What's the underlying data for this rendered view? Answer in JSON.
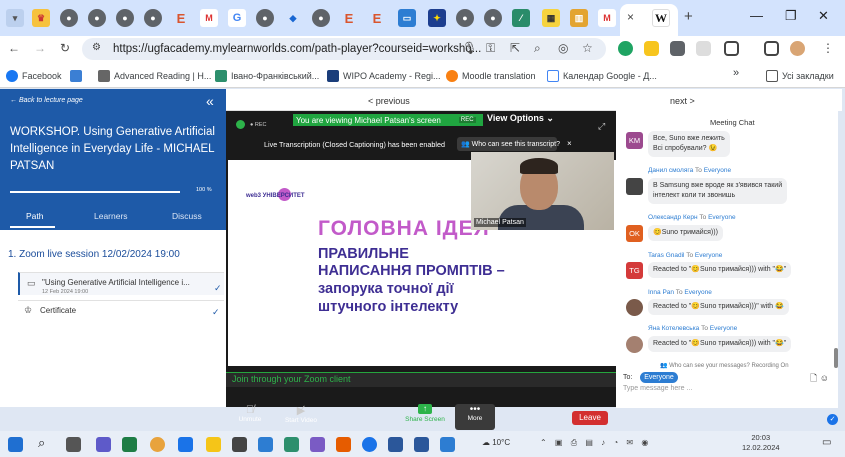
{
  "browser": {
    "url": "https://ugfacademy.mylearnworlds.com/path-player?courseid=worksho...",
    "active_tab_letter": "W",
    "tab_close": "×",
    "new_tab": "+",
    "bookmarks": [
      {
        "label": "Facebook"
      },
      {
        "label": "Advanced Reading | H..."
      },
      {
        "label": "Івано-Франківський..."
      },
      {
        "label": "WIPO Academy - Regi..."
      },
      {
        "label": "Moodle translation"
      },
      {
        "label": "Календар Google - Д..."
      }
    ],
    "bookmarks_more": "»",
    "all_bookmarks": "Усі закладки"
  },
  "course": {
    "back_label": "Back to lecture page",
    "title": "WORKSHOP. Using Generative Artificial Intelligence in Everyday Life - MICHAEL PATSAN",
    "progress_label": "100 %",
    "progress_value": 100,
    "tabs": [
      "Path",
      "Learners",
      "Discuss"
    ],
    "section": "1. Zoom live session 12/02/2024 19:00",
    "items": [
      {
        "title": "\"Using Generative Artificial Intelligence i...",
        "date": "12 Feb 2024 19:00"
      },
      {
        "title": "Certificate",
        "date": ""
      }
    ]
  },
  "player_nav": {
    "previous": "< previous",
    "next": "next >"
  },
  "zoom": {
    "viewing_banner": "You are viewing Michael Patsan's screen",
    "rec_badge": "REC",
    "view_options": "View Options ⌄",
    "transcription_notice": "Live Transcription (Closed Captioning) has been enabled",
    "who_can_see": "Who can see this transcript?",
    "close": "×",
    "speaker_name": "Michael Patsan",
    "slide": {
      "heading": "ГОЛОВНА ІДЕЯ",
      "line1": "ПРАВИЛЬНЕ",
      "line2": "НАПИСАННЯ ПРОМПТІВ –",
      "line3": "запорука точної дії",
      "line4": "штучного інтелекту",
      "logo_text": "web3 УНІВЕРСИТЕТ"
    },
    "join_link": "Join through your Zoom client",
    "controls": {
      "unmute": "Unmute",
      "start_video": "Start Video",
      "share_screen": "Share Screen",
      "more": "More",
      "leave": "Leave"
    }
  },
  "chat": {
    "title": "Meeting Chat",
    "messages": [
      {
        "avatar": "KM",
        "avatar_color": "#9c4a8f",
        "sender": "",
        "to": "",
        "text": "Все, Suno вже лежить\nВсі спробували? 😉"
      },
      {
        "avatar": "",
        "avatar_color": "#555",
        "sender": "Данил смоляга",
        "to": "Everyone",
        "text": "В Samsung вже вроде як з'явився такий\nінтелект коли ти звонишь"
      },
      {
        "avatar": "OK",
        "avatar_color": "#e06020",
        "sender": "Олександр Керн",
        "to": "Everyone",
        "text": "😊Suno тримайся)))"
      },
      {
        "avatar": "TG",
        "avatar_color": "#d43a3a",
        "sender": "Taras Gnadil",
        "to": "Everyone",
        "text": "Reacted to \"😊Suno тримайся))) with \"😂\""
      },
      {
        "avatar": "",
        "avatar_color": "#7a5a4a",
        "sender": "Inna Pan",
        "to": "Everyone",
        "text": "Reacted to \"😊Suno тримайся)))\" with 😂"
      },
      {
        "avatar": "",
        "avatar_color": "#a48070",
        "sender": "Яна Котелевська",
        "to": "Everyone",
        "text": "Reacted to \"😊Suno тримайся))) with \"😂\""
      }
    ],
    "who_can_see": "Who can see your messages? Recording On",
    "to_label": "To:",
    "to_value": "Everyone",
    "placeholder": "Type message here ..."
  },
  "taskbar": {
    "weather": "10°C",
    "time": "20:03",
    "date": "12.02.2024"
  }
}
